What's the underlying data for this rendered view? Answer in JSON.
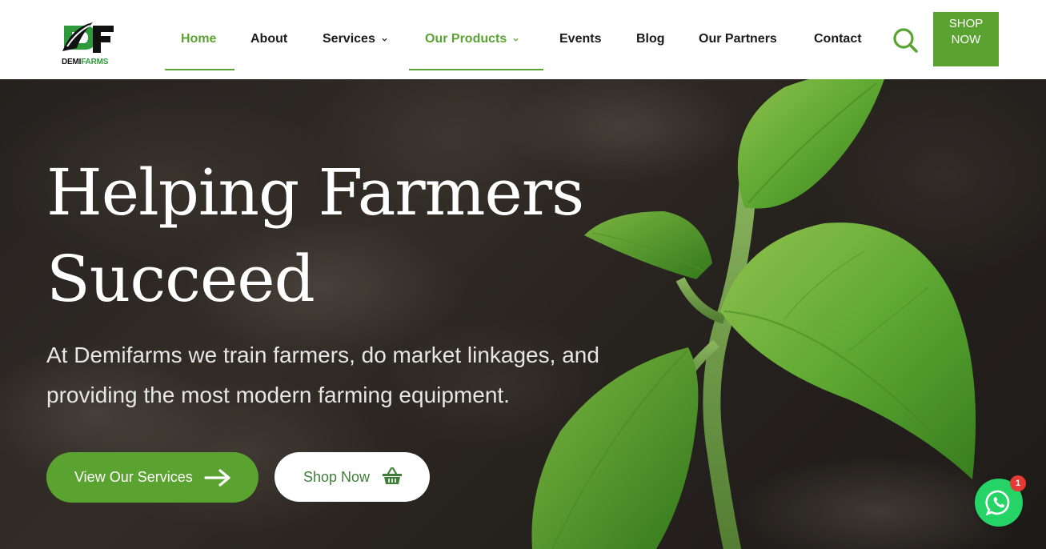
{
  "header": {
    "logo": {
      "brand_a": "DEMI",
      "brand_b": "FARMS"
    },
    "nav": [
      {
        "label": "Home",
        "active": true,
        "has_dropdown": false
      },
      {
        "label": "About",
        "active": false,
        "has_dropdown": false
      },
      {
        "label": "Services",
        "active": false,
        "has_dropdown": true
      },
      {
        "label": "Our Products",
        "active": true,
        "has_dropdown": true
      },
      {
        "label": "Events",
        "active": false,
        "has_dropdown": false
      },
      {
        "label": "Blog",
        "active": false,
        "has_dropdown": false
      },
      {
        "label": "Our Partners",
        "active": false,
        "has_dropdown": false
      },
      {
        "label": "Contact",
        "active": false,
        "has_dropdown": false
      }
    ],
    "search_icon": "search-icon",
    "shop_button": "SHOP NOW"
  },
  "hero": {
    "title": "Helping Farmers Succeed",
    "subtitle": "At Demifarms we train farmers, do market linkages, and providing the most modern farming equipment.",
    "primary_button": "View Our Services",
    "primary_icon": "arrow-right-icon",
    "secondary_button": "Shop Now",
    "secondary_icon": "basket-icon"
  },
  "whatsapp": {
    "icon": "whatsapp-icon",
    "badge": "1"
  },
  "colors": {
    "accent": "#5aa331",
    "nav_text": "#1a1a1a",
    "hero_text": "#ffffff",
    "whatsapp": "#25d366",
    "badge": "#e53935"
  }
}
